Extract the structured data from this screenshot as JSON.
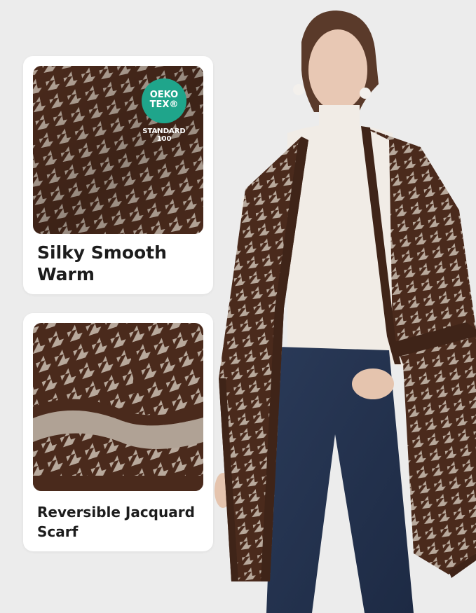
{
  "certification": {
    "line1": "OEKO",
    "line2": "TEX®",
    "standard": "STANDARD",
    "number": "100"
  },
  "features": [
    {
      "lines": [
        "Silky Smooth",
        "Warm"
      ]
    },
    {
      "lines": [
        "Reversible Jacquard",
        "Scarf"
      ]
    }
  ],
  "colors": {
    "brown": "#4a2a1c",
    "beige": "#b9ab9f",
    "badge_green": "#1fa58b"
  }
}
